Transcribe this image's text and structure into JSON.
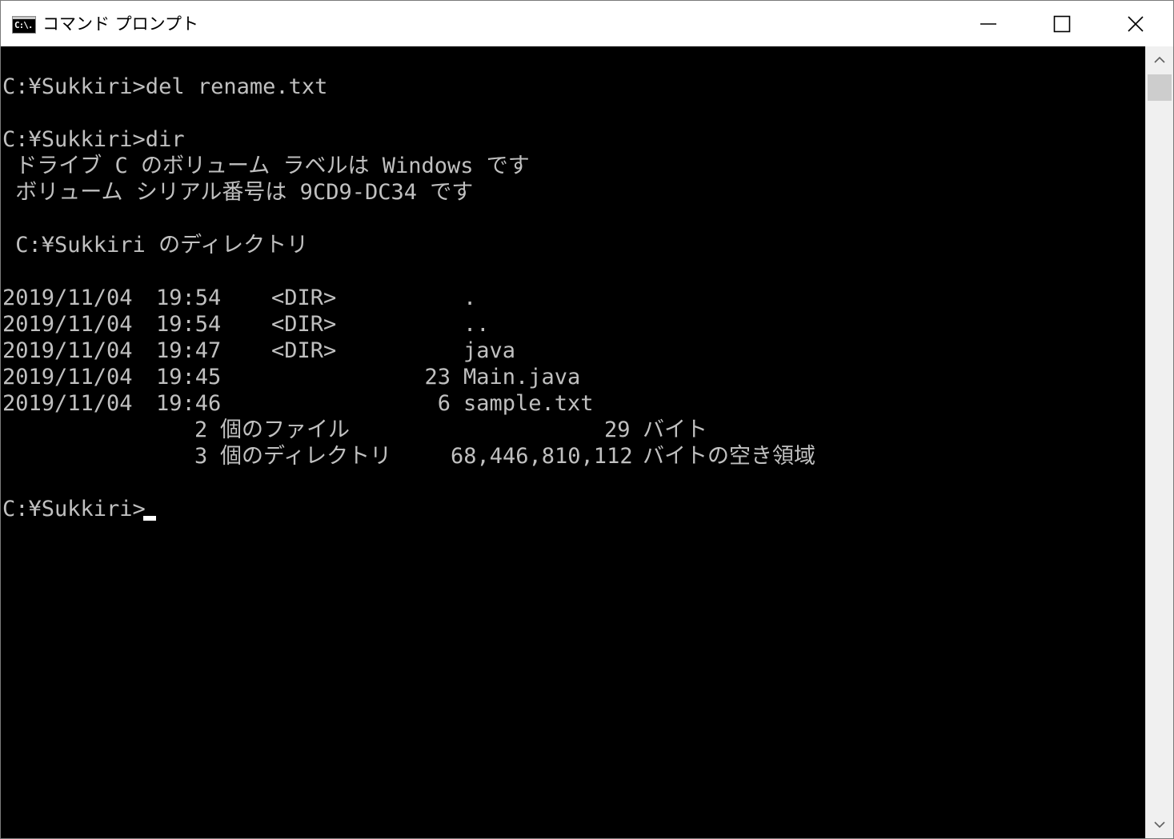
{
  "window": {
    "title": "コマンド プロンプト",
    "icon_label": "C:\\."
  },
  "console": {
    "lines": [
      "C:¥Sukkiri>del rename.txt",
      "C:¥Sukkiri>dir",
      " ドライブ C のボリューム ラベルは Windows です",
      " ボリューム シリアル番号は 9CD9-DC34 です",
      " C:¥Sukkiri のディレクトリ"
    ],
    "dir_entries": [
      {
        "date": "2019/11/04",
        "time": "19:54",
        "type": "<DIR>",
        "size": "",
        "name": "."
      },
      {
        "date": "2019/11/04",
        "time": "19:54",
        "type": "<DIR>",
        "size": "",
        "name": ".."
      },
      {
        "date": "2019/11/04",
        "time": "19:47",
        "type": "<DIR>",
        "size": "",
        "name": "java"
      },
      {
        "date": "2019/11/04",
        "time": "19:45",
        "type": "",
        "size": "23",
        "name": "Main.java"
      },
      {
        "date": "2019/11/04",
        "time": "19:46",
        "type": "",
        "size": "6",
        "name": "sample.txt"
      }
    ],
    "summary": {
      "files_count": "2",
      "files_label": "個のファイル",
      "files_bytes": "29",
      "bytes_label": "バイト",
      "dirs_count": "3",
      "dirs_label": "個のディレクトリ",
      "free_bytes": "68,446,810,112",
      "free_label": "バイトの空き領域"
    },
    "prompt": "C:¥Sukkiri>"
  },
  "icons": {
    "minimize": "minimize-icon",
    "maximize": "maximize-icon",
    "close": "close-icon",
    "scroll_up": "chevron-up-icon",
    "scroll_down": "chevron-down-icon"
  },
  "colors": {
    "console_bg": "#000000",
    "console_text": "#c0c0c0",
    "titlebar_bg": "#ffffff"
  }
}
